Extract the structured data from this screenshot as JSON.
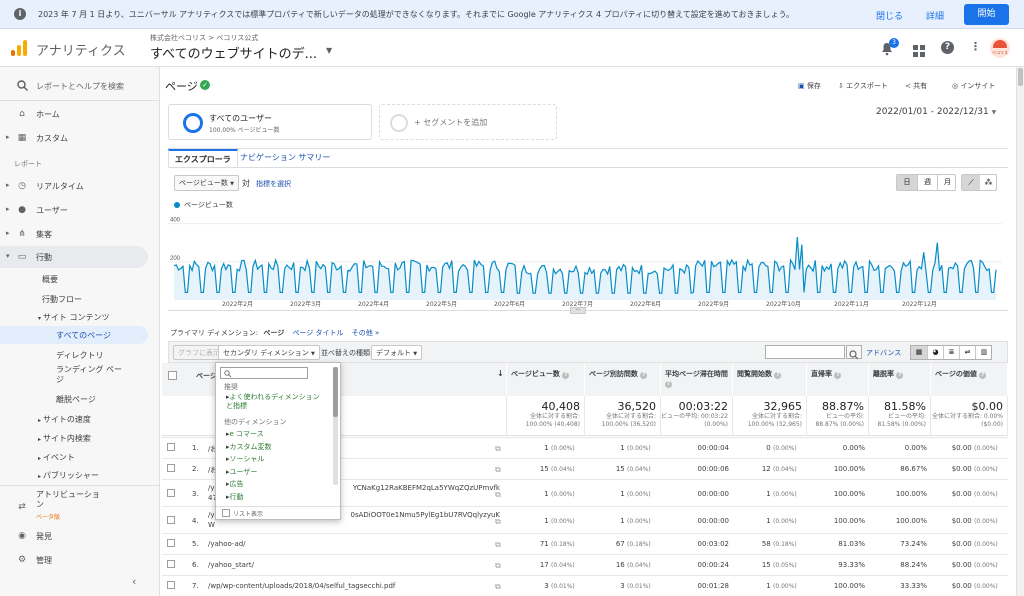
{
  "banner": {
    "message": "2023 年 7 月 1 日より、ユニバーサル アナリティクスでは標準プロパティで新しいデータの処理ができなくなります。それまでに Google アナリティクス 4 プロパティに切り替えて設定を進めておきましょう。",
    "close": "閉じる",
    "detail": "詳細",
    "start": "開始"
  },
  "header": {
    "app_name": "アナリティクス",
    "breadcrumb": "株式会社ベコリス > ベコリス公式",
    "view_name": "すべてのウェブサイトのデ...",
    "notif_count": "3",
    "avatar_text": "ベコリス"
  },
  "sidebar": {
    "search": "レポートとヘルプを検索",
    "home": "ホーム",
    "custom": "カスタム",
    "reports_label": "レポート",
    "realtime": "リアルタイム",
    "users": "ユーザー",
    "acquisition": "集客",
    "behavior": "行動",
    "overview": "概要",
    "flow": "行動フロー",
    "site_content": "サイト コンテンツ",
    "all_pages": "すべてのページ",
    "directory": "ディレクトリ",
    "landing": "ランディング ページ",
    "exit": "離脱ページ",
    "speed": "サイトの速度",
    "site_search": "サイト内検索",
    "events": "イベント",
    "publisher": "パブリッシャー",
    "attribution": "アトリビューション",
    "beta": "ベータ版",
    "discover": "発見",
    "admin": "管理"
  },
  "page": {
    "title": "ページ",
    "save": "保存",
    "export": "エクスポート",
    "share": "共有",
    "insight": "インサイト",
    "date_range": "2022/01/01 - 2022/12/31",
    "segment_name": "すべてのユーザー",
    "segment_sub": "100.00% ページビュー数",
    "add_segment": "+ セグメントを追加",
    "tab_explorer": "エクスプローラ",
    "tab_nav": "ナビゲーション サマリー",
    "metric_sel": "ページビュー数",
    "vs": "対",
    "choose_metric": "指標を選択",
    "day": "日",
    "week": "週",
    "month": "月"
  },
  "chart_data": {
    "type": "line",
    "title": "",
    "series": [
      {
        "name": "ページビュー数"
      }
    ],
    "ylim": [
      0,
      440
    ],
    "yticks": [
      "400",
      "200"
    ],
    "x_ticks": [
      "2022年2月",
      "2022年3月",
      "2022年4月",
      "2022年5月",
      "2022年6月",
      "2022年7月",
      "2022年8月",
      "2022年9月",
      "2022年10月",
      "2022年11月",
      "2022年12月"
    ],
    "grid": true,
    "legend": "top-left",
    "color": "#058dc7"
  },
  "dims": {
    "label": "プライマリ ディメンション:",
    "page": "ページ",
    "page_title": "ページ タイトル",
    "other": "その他 »"
  },
  "toolbar": {
    "plot": "グラフに表示",
    "secondary": "セカンダリ ディメンション",
    "sort_label": "並べ替えの種類:",
    "sort": "デフォルト",
    "advanced": "アドバンス"
  },
  "dropdown": {
    "recommended": "推奨",
    "frequent": "よく使われるディメンションと指標",
    "other": "他のディメンション",
    "items": [
      "e コマース",
      "カスタム変数",
      "ソーシャル",
      "ユーザー",
      "広告",
      "行動"
    ],
    "list": "リスト表示"
  },
  "table": {
    "page_col": "ページ",
    "headers": [
      "ページビュー数",
      "ページ別訪問数",
      "平均ページ滞在時間",
      "閲覧開始数",
      "直帰率",
      "離脱率",
      "ページの価値"
    ],
    "totals": [
      {
        "v": "40,408",
        "s": "全体に対する割合: 100.00% (40,408)"
      },
      {
        "v": "36,520",
        "s": "全体に対する割合: 100.00% (36,520)"
      },
      {
        "v": "00:03:22",
        "s": "ビューの平均: 00:03:22 (0.00%)"
      },
      {
        "v": "32,965",
        "s": "全体に対する割合: 100.00% (32,965)"
      },
      {
        "v": "88.87%",
        "s": "ビューの平均: 88.87% (0.00%)"
      },
      {
        "v": "81.58%",
        "s": "ビューの平均: 81.58% (0.00%)"
      },
      {
        "v": "$0.00",
        "s": "全体に対する割合: 0.00% ($0.00)"
      }
    ],
    "rows": [
      {
        "n": "1.",
        "page": "/お",
        "pv": "1",
        "pvp": "(0.00%)",
        "uv": "1",
        "uvp": "(0.00%)",
        "t": "00:00:04",
        "en": "0",
        "enp": "(0.00%)",
        "b": "0.00%",
        "e": "0.00%",
        "val": "$0.00",
        "vp": "(0.00%)"
      },
      {
        "n": "2.",
        "page": "/お",
        "pv": "15",
        "pvp": "(0.04%)",
        "uv": "15",
        "uvp": "(0.04%)",
        "t": "00:00:06",
        "en": "12",
        "enp": "(0.04%)",
        "b": "100.00%",
        "e": "86.67%",
        "val": "$0.00",
        "vp": "(0.00%)"
      },
      {
        "n": "3.",
        "page": "/ya",
        "page2": "YCNaKg12RaKBEFM2qLa5YWqZQzUPmvfk",
        "page3": "47",
        "pv": "1",
        "pvp": "(0.00%)",
        "uv": "1",
        "uvp": "(0.00%)",
        "t": "00:00:00",
        "en": "1",
        "enp": "(0.00%)",
        "b": "100.00%",
        "e": "100.00%",
        "val": "$0.00",
        "vp": "(0.00%)"
      },
      {
        "n": "4.",
        "page": "/ya",
        "page2": "0sADiOOT0e1Nmu5PylEg1bU7RVQqlyzyuK",
        "page3": "W",
        "pv": "1",
        "pvp": "(0.00%)",
        "uv": "1",
        "uvp": "(0.00%)",
        "t": "00:00:00",
        "en": "1",
        "enp": "(0.00%)",
        "b": "100.00%",
        "e": "100.00%",
        "val": "$0.00",
        "vp": "(0.00%)"
      },
      {
        "n": "5.",
        "page": "/yahoo-ad/",
        "pv": "71",
        "pvp": "(0.18%)",
        "uv": "67",
        "uvp": "(0.18%)",
        "t": "00:03:02",
        "en": "58",
        "enp": "(0.18%)",
        "b": "81.03%",
        "e": "73.24%",
        "val": "$0.00",
        "vp": "(0.00%)"
      },
      {
        "n": "6.",
        "page": "/yahoo_start/",
        "pv": "17",
        "pvp": "(0.04%)",
        "uv": "16",
        "uvp": "(0.04%)",
        "t": "00:00:24",
        "en": "15",
        "enp": "(0.05%)",
        "b": "93.33%",
        "e": "88.24%",
        "val": "$0.00",
        "vp": "(0.00%)"
      },
      {
        "n": "7.",
        "page": "/wp/wp-content/uploads/2018/04/selful_tagsecchi.pdf",
        "pv": "3",
        "pvp": "(0.01%)",
        "uv": "3",
        "uvp": "(0.01%)",
        "t": "00:01:28",
        "en": "1",
        "enp": "(0.00%)",
        "b": "100.00%",
        "e": "33.33%",
        "val": "$0.00",
        "vp": "(0.00%)"
      }
    ]
  },
  "colors": {
    "accent": "#1a73e8",
    "line": "#058dc7",
    "logo_orange": "#f9ab00",
    "logo_dark": "#e37400",
    "green": "#2d7d34"
  },
  "icons": [
    "info-icon",
    "search-icon",
    "home-icon",
    "grid-icon",
    "clock-icon",
    "person-icon",
    "acquisition-icon",
    "behavior-icon",
    "attribution-icon",
    "bulb-icon",
    "gear-icon",
    "bell-icon",
    "apps-icon",
    "help-icon",
    "more-icon",
    "save-icon",
    "export-icon",
    "share-icon",
    "insight-icon",
    "check-icon"
  ]
}
